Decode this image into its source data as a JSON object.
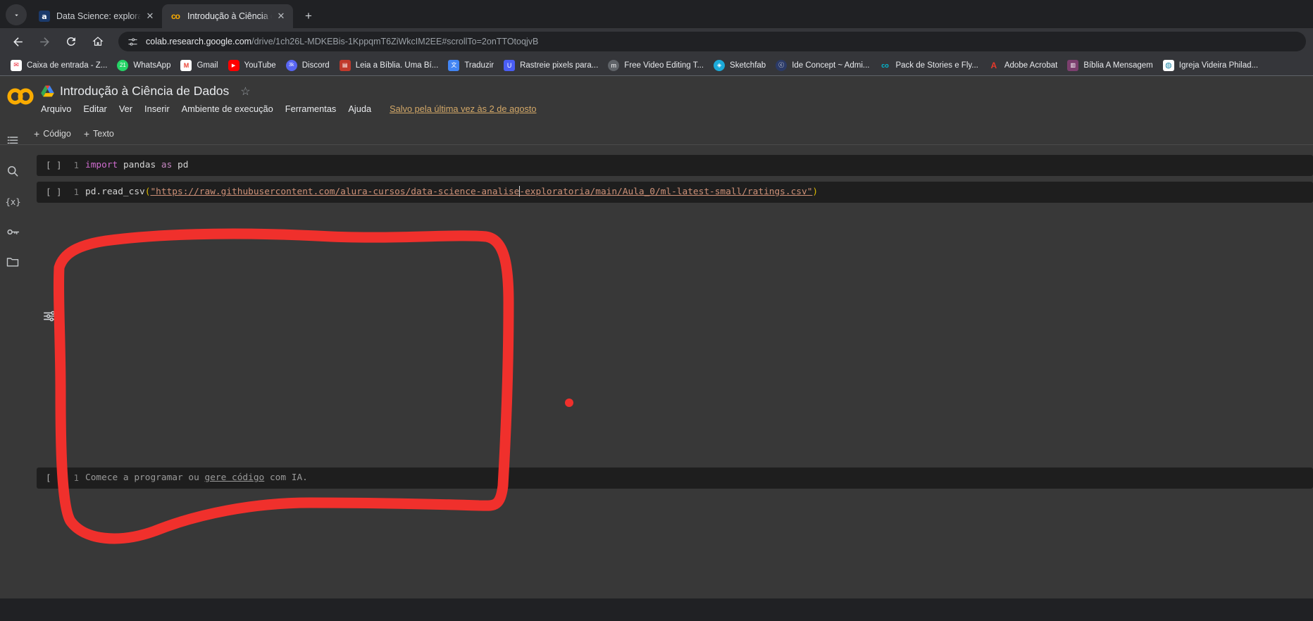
{
  "browser": {
    "tabs": [
      {
        "title": "Data Science: explorando e ana",
        "favicon": "alura-icon",
        "active": false
      },
      {
        "title": "Introdução à Ciência de Dados",
        "favicon": "colab-icon",
        "active": true
      }
    ],
    "new_tab_label": "+",
    "tab_close_label": "✕",
    "tab_list_label": "⌄",
    "nav": {
      "back": "←",
      "forward": "→",
      "reload": "⟳",
      "home": "⌂"
    },
    "omnibox": {
      "site_settings_icon": "tune-icon",
      "url_host": "colab.research.google.com",
      "url_path": "/drive/1ch26L-MDKEBis-1KppqmT6ZiWkcIM2EE#scrollTo=2onTTOtoqjvB"
    },
    "bookmarks": [
      {
        "label": "Caixa de entrada - Z...",
        "icon": "zoho-mail-icon",
        "color": "#ffffff",
        "glyph": "✉"
      },
      {
        "label": "WhatsApp",
        "icon": "whatsapp-icon",
        "color": "#25d366",
        "glyph": "21"
      },
      {
        "label": "Gmail",
        "icon": "gmail-icon",
        "color": "#ffffff",
        "glyph": "M"
      },
      {
        "label": "YouTube",
        "icon": "youtube-icon",
        "color": "#ff0000",
        "glyph": "▶"
      },
      {
        "label": "Discord",
        "icon": "discord-icon",
        "color": "#5865f2",
        "glyph": "3k"
      },
      {
        "label": "Leia a Bíblia. Uma Bí...",
        "icon": "bible-icon",
        "color": "#c0392b",
        "glyph": "📕"
      },
      {
        "label": "Traduzir",
        "icon": "translate-icon",
        "color": "#4285f4",
        "glyph": "文"
      },
      {
        "label": "Rastreie pixels para...",
        "icon": "pixel-tracker-icon",
        "color": "#4a5ef5",
        "glyph": "U"
      },
      {
        "label": "Free Video Editing T...",
        "icon": "m-icon",
        "color": "#5f6368",
        "glyph": "m"
      },
      {
        "label": "Sketchfab",
        "icon": "sketchfab-icon",
        "color": "#1caad9",
        "glyph": "◈"
      },
      {
        "label": "Ide Concept ~ Admi...",
        "icon": "ide-concept-icon",
        "color": "#2b3a67",
        "glyph": "ⓒ"
      },
      {
        "label": "Pack de Stories e Fly...",
        "icon": "colab-icon",
        "color": "#00bcd4",
        "glyph": "co"
      },
      {
        "label": "Adobe Acrobat",
        "icon": "adobe-acrobat-icon",
        "color": "#e8392b",
        "glyph": "A"
      },
      {
        "label": "Bíblia A Mensagem",
        "icon": "bible-message-icon",
        "color": "#7b3f6e",
        "glyph": "📖"
      },
      {
        "label": "Igreja Videira Philad...",
        "icon": "globe-icon",
        "color": "#1e88a8",
        "glyph": "🌐"
      }
    ]
  },
  "colab": {
    "logo_label": "CO",
    "drive_icon": "google-drive-icon",
    "doc_title": "Introdução à Ciência de Dados",
    "star_icon": "☆",
    "menu": [
      "Arquivo",
      "Editar",
      "Ver",
      "Inserir",
      "Ambiente de execução",
      "Ferramentas",
      "Ajuda"
    ],
    "save_status": "Salvo pela última vez às 2 de agosto",
    "cell_toolbar": {
      "add_code": "Código",
      "add_text": "Texto",
      "plus": "+"
    },
    "rail_icons": [
      "table-of-contents-icon",
      "search-icon",
      "variables-icon",
      "secrets-key-icon",
      "files-folder-icon"
    ],
    "output_tool_icon": "output-settings-icon",
    "cells": [
      {
        "run_label": "[ ]",
        "line_number": "1",
        "tokens": [
          {
            "text": "import",
            "type": "kw"
          },
          {
            "text": " pandas ",
            "type": "plain"
          },
          {
            "text": "as",
            "type": "kw"
          },
          {
            "text": " pd",
            "type": "plain"
          }
        ],
        "plain_code": "import pandas as pd"
      },
      {
        "run_label": "[ ]",
        "line_number": "1",
        "tokens": [
          {
            "text": "pd.read_csv",
            "type": "plain"
          },
          {
            "text": "(",
            "type": "paren"
          },
          {
            "text": "\"https://raw.githubusercontent.com/alura-cursos/data-science-analise",
            "type": "str"
          },
          {
            "text": "-exploratoria/main/Aula_0/ml-latest-small/ratings.csv\"",
            "type": "str"
          },
          {
            "text": ")",
            "type": "paren"
          }
        ],
        "plain_code": "pd.read_csv(\"https://raw.githubusercontent.com/alura-cursos/data-science-analise-exploratoria/main/Aula_0/ml-latest-small/ratings.csv\")"
      },
      {
        "run_label": "[ ]",
        "line_number": "1",
        "ghost_prefix": "Comece a programar ou ",
        "ghost_link": "gere código",
        "ghost_suffix": " com IA."
      }
    ]
  },
  "annotation": {
    "color": "#f0302c",
    "shape": "hand-drawn-rectangle-highlight",
    "dot_color": "#f0302c"
  }
}
